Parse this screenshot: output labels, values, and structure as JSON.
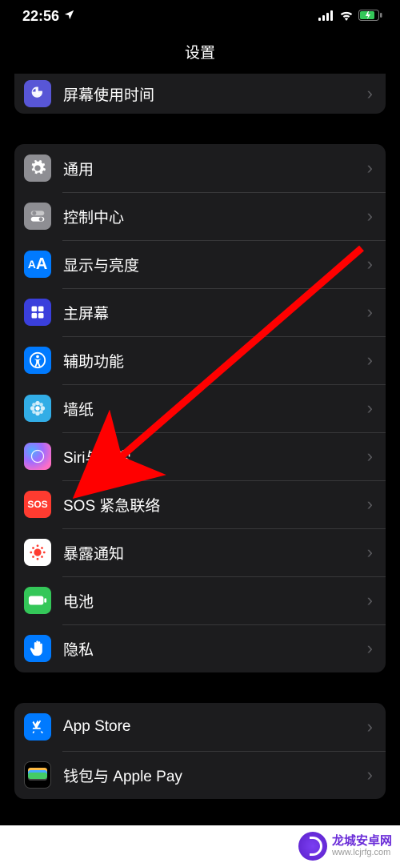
{
  "status": {
    "time": "22:56",
    "battery_charging": true
  },
  "header": {
    "title": "设置"
  },
  "group0": {
    "items": [
      {
        "label": "屏幕使用时间"
      }
    ]
  },
  "group1": {
    "items": [
      {
        "label": "通用"
      },
      {
        "label": "控制中心"
      },
      {
        "label": "显示与亮度"
      },
      {
        "label": "主屏幕"
      },
      {
        "label": "辅助功能"
      },
      {
        "label": "墙纸"
      },
      {
        "label": "Siri与搜索"
      },
      {
        "label": "SOS 紧急联络"
      },
      {
        "label": "暴露通知"
      },
      {
        "label": "电池"
      },
      {
        "label": "隐私"
      }
    ]
  },
  "group2": {
    "items": [
      {
        "label": "App Store"
      },
      {
        "label": "钱包与 Apple Pay"
      }
    ]
  },
  "watermark": {
    "title": "龙城安卓网",
    "url": "www.lcjrfg.com"
  },
  "annotation": {
    "arrow_color": "#ff0000",
    "target": "Siri与搜索"
  }
}
